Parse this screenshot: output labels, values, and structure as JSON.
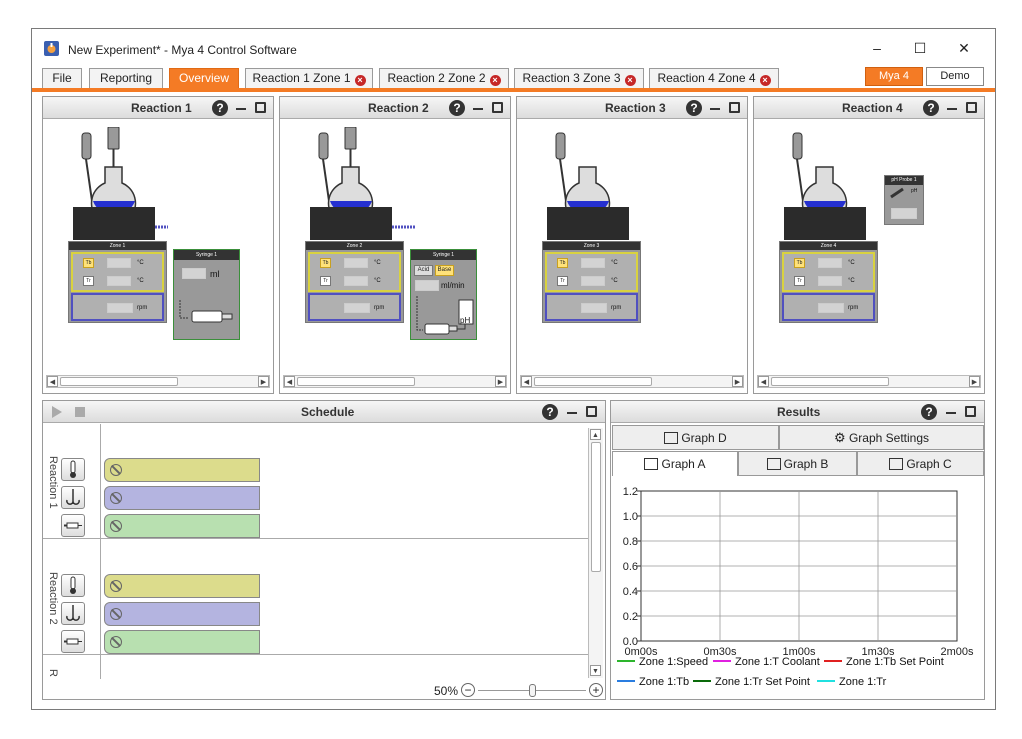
{
  "window": {
    "title": "New Experiment* - Mya 4 Control Software",
    "minimize": "–",
    "maximize": "☐",
    "close": "✕"
  },
  "tabs": [
    {
      "label": "File"
    },
    {
      "label": "Reporting"
    },
    {
      "label": "Overview"
    },
    {
      "label": "Reaction 1 Zone 1"
    },
    {
      "label": "Reaction 2 Zone 2"
    },
    {
      "label": "Reaction 3 Zone 3"
    },
    {
      "label": "Reaction 4 Zone 4"
    }
  ],
  "right_buttons": {
    "mya4": "Mya 4",
    "demo": "Demo"
  },
  "reactions": [
    {
      "title": "Reaction 1",
      "zone": "Zone 1",
      "tb": "Tb",
      "tr": "Tr",
      "unit_c": "°C",
      "rpm": "rpm",
      "syringe": "Syringe 1",
      "ml": "ml"
    },
    {
      "title": "Reaction 2",
      "zone": "Zone 2",
      "tb": "Tb",
      "tr": "Tr",
      "unit_c": "°C",
      "rpm": "rpm",
      "syringe": "Syringe 1",
      "acid": "Acid",
      "base": "Base",
      "mlmin": "ml/min",
      "ph": "pH"
    },
    {
      "title": "Reaction 3",
      "zone": "Zone 3",
      "tb": "Tb",
      "tr": "Tr",
      "unit_c": "°C",
      "rpm": "rpm"
    },
    {
      "title": "Reaction 4",
      "zone": "Zone 4",
      "tb": "Tb",
      "tr": "Tr",
      "unit_c": "°C",
      "rpm": "rpm",
      "probe": "pH Probe 1",
      "probe_ph": "pH"
    }
  ],
  "panel_help": "?",
  "schedule": {
    "title": "Schedule",
    "row1": "Reaction 1",
    "row2": "Reaction 2",
    "row3": "R",
    "zoom": "50%"
  },
  "results": {
    "title": "Results",
    "tabs_top": [
      "Graph D",
      "Graph Settings"
    ],
    "tabs": [
      "Graph A",
      "Graph B",
      "Graph C"
    ]
  },
  "chart_data": {
    "type": "line",
    "yticks": [
      "1.2",
      "1.0",
      "0.8",
      "0.6",
      "0.4",
      "0.2",
      "0.0"
    ],
    "xticks": [
      "0m00s",
      "0m30s",
      "1m00s",
      "1m30s",
      "2m00s"
    ],
    "ylim": [
      0,
      1.2
    ],
    "grid": true,
    "legend_position": "bottom",
    "series": [
      {
        "name": "Zone 1:Speed",
        "color": "#2db52d",
        "values": []
      },
      {
        "name": "Zone 1:T Coolant",
        "color": "#e020e0",
        "values": []
      },
      {
        "name": "Zone 1:Tb Set Point",
        "color": "#e02020",
        "values": []
      },
      {
        "name": "Zone 1:Tb",
        "color": "#2a7de0",
        "values": []
      },
      {
        "name": "Zone 1:Tr Set Point",
        "color": "#0a6a0a",
        "values": []
      },
      {
        "name": "Zone 1:Tr",
        "color": "#20e0e0",
        "values": []
      }
    ]
  },
  "colors": {
    "accent": "#f47b25",
    "thermo_bar": "#dcdc8c",
    "stir_bar": "#b4b4e0",
    "dose_bar": "#b8e0b0"
  }
}
